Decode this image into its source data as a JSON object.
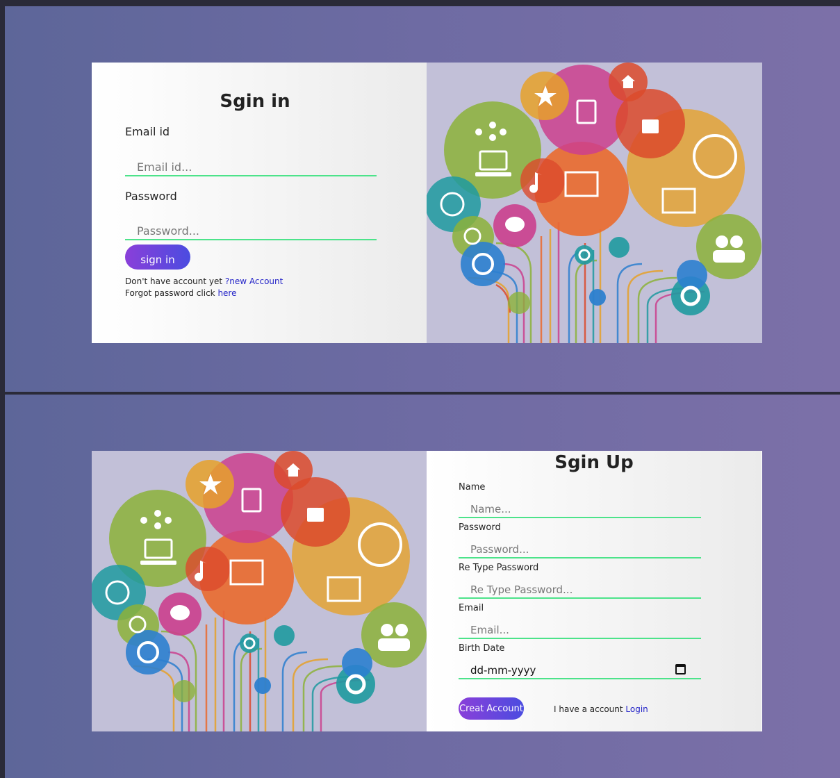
{
  "signin": {
    "title": "Sgin in",
    "email_label": "Email id",
    "email_placeholder": "Email id...",
    "password_label": "Password",
    "password_placeholder": "Password...",
    "button_label": "sign in",
    "no_account_text": "Don't have account yet ",
    "new_account_link": "?new Account",
    "forgot_text": "Forgot password click ",
    "forgot_link": "here"
  },
  "signup": {
    "title": "Sgin Up",
    "name_label": "Name",
    "name_placeholder": "Name...",
    "password_label": "Password",
    "password_placeholder": "Password...",
    "retype_label": "Re Type Password",
    "retype_placeholder": "Re Type Password...",
    "email_label": "Email",
    "email_placeholder": "Email...",
    "birth_label": "Birth Date",
    "birth_value": "dd-mm-yyyy",
    "button_label": "Creat Account",
    "have_account_text": "I have a account ",
    "login_link": "Login"
  },
  "illustration": {
    "icons": [
      "star-icon",
      "notepad-icon",
      "home-icon",
      "basket-icon",
      "network-icon",
      "laptop-icon",
      "music-note-icon",
      "tablet-touch-icon",
      "globe-icon",
      "mail-icon",
      "upload-icon",
      "chat-icon",
      "download-icon",
      "phone-icon",
      "gear-icon",
      "users-icon"
    ],
    "colors": {
      "background": "#c2c0d8",
      "magenta": "#cb3f8e",
      "orange": "#ea6a2e",
      "green": "#8cb23a",
      "teal": "#1f9aa0",
      "amber": "#e6a12a",
      "red": "#dc4a2c",
      "blue": "#2c7fcf"
    }
  },
  "theme": {
    "accent_green": "#4ce38a",
    "button_gradient_start": "#8a3fd9",
    "button_gradient_end": "#4b4ce0",
    "link_color": "#2424c8"
  }
}
